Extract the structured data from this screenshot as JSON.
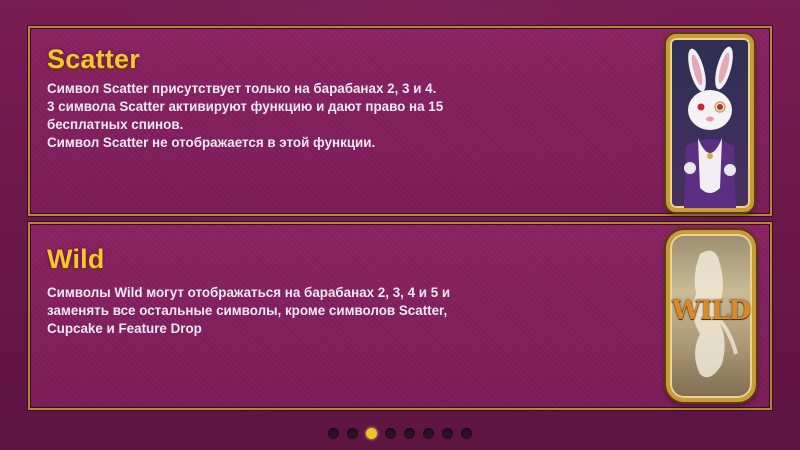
{
  "scatter": {
    "title": "Scatter",
    "lines": [
      "Символ Scatter присутствует только на барабанах 2, 3 и 4.",
      "3 символа Scatter активируют функцию и дают право на 15",
      "бесплатных спинов.",
      "Символ Scatter не отображается в этой функции."
    ]
  },
  "wild": {
    "title": "Wild",
    "lines": [
      "Символы Wild могут отображаться на барабанах 2, 3, 4 и 5 и",
      "заменять все остальные символы, кроме символов Scatter,",
      "Cupcake и Feature Drop"
    ],
    "symbol_text": "WILD"
  },
  "pagination": {
    "total_pages": 8,
    "current_page": 3
  },
  "colors": {
    "background": "#6a174b",
    "title": "#f7c52f",
    "gold_border": "#b3892f",
    "active_dot": "#f2c02d"
  }
}
